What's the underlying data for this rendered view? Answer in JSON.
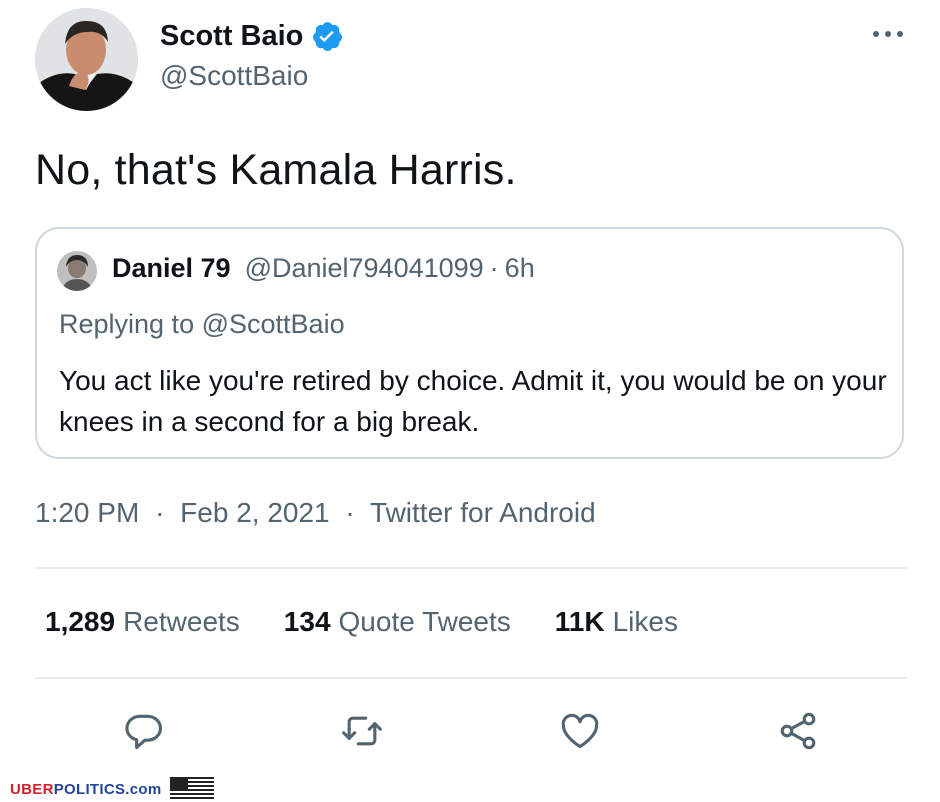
{
  "user": {
    "name": "Scott Baio",
    "handle": "@ScottBaio",
    "verified": true
  },
  "tweet": {
    "text": "No, that's Kamala Harris."
  },
  "quoted_tweet": {
    "name": "Daniel 79",
    "handle": "@Daniel794041099",
    "separator": "·",
    "time": "6h",
    "replying_prefix": "Replying to",
    "replying_to": "@ScottBaio",
    "text": "You act like you're retired by choice. Admit it, you would be on your knees in a second for a big break."
  },
  "meta": {
    "time": "1:20 PM",
    "date": "Feb 2, 2021",
    "source": "Twitter for Android",
    "separator": "·"
  },
  "stats": {
    "retweets_count": "1,289",
    "retweets_label": "Retweets",
    "quotes_count": "134",
    "quotes_label": "Quote Tweets",
    "likes_count": "11K",
    "likes_label": "Likes"
  },
  "actions": [
    "reply-icon",
    "retweet-icon",
    "like-icon",
    "share-icon"
  ],
  "watermark": {
    "part1": "UBER",
    "part2": "POLITICS",
    "part3": ".com"
  },
  "colors": {
    "accent": "#1d9bf0",
    "secondary_text": "#536471",
    "primary_text": "#0f1419",
    "border": "#cfd9de"
  }
}
